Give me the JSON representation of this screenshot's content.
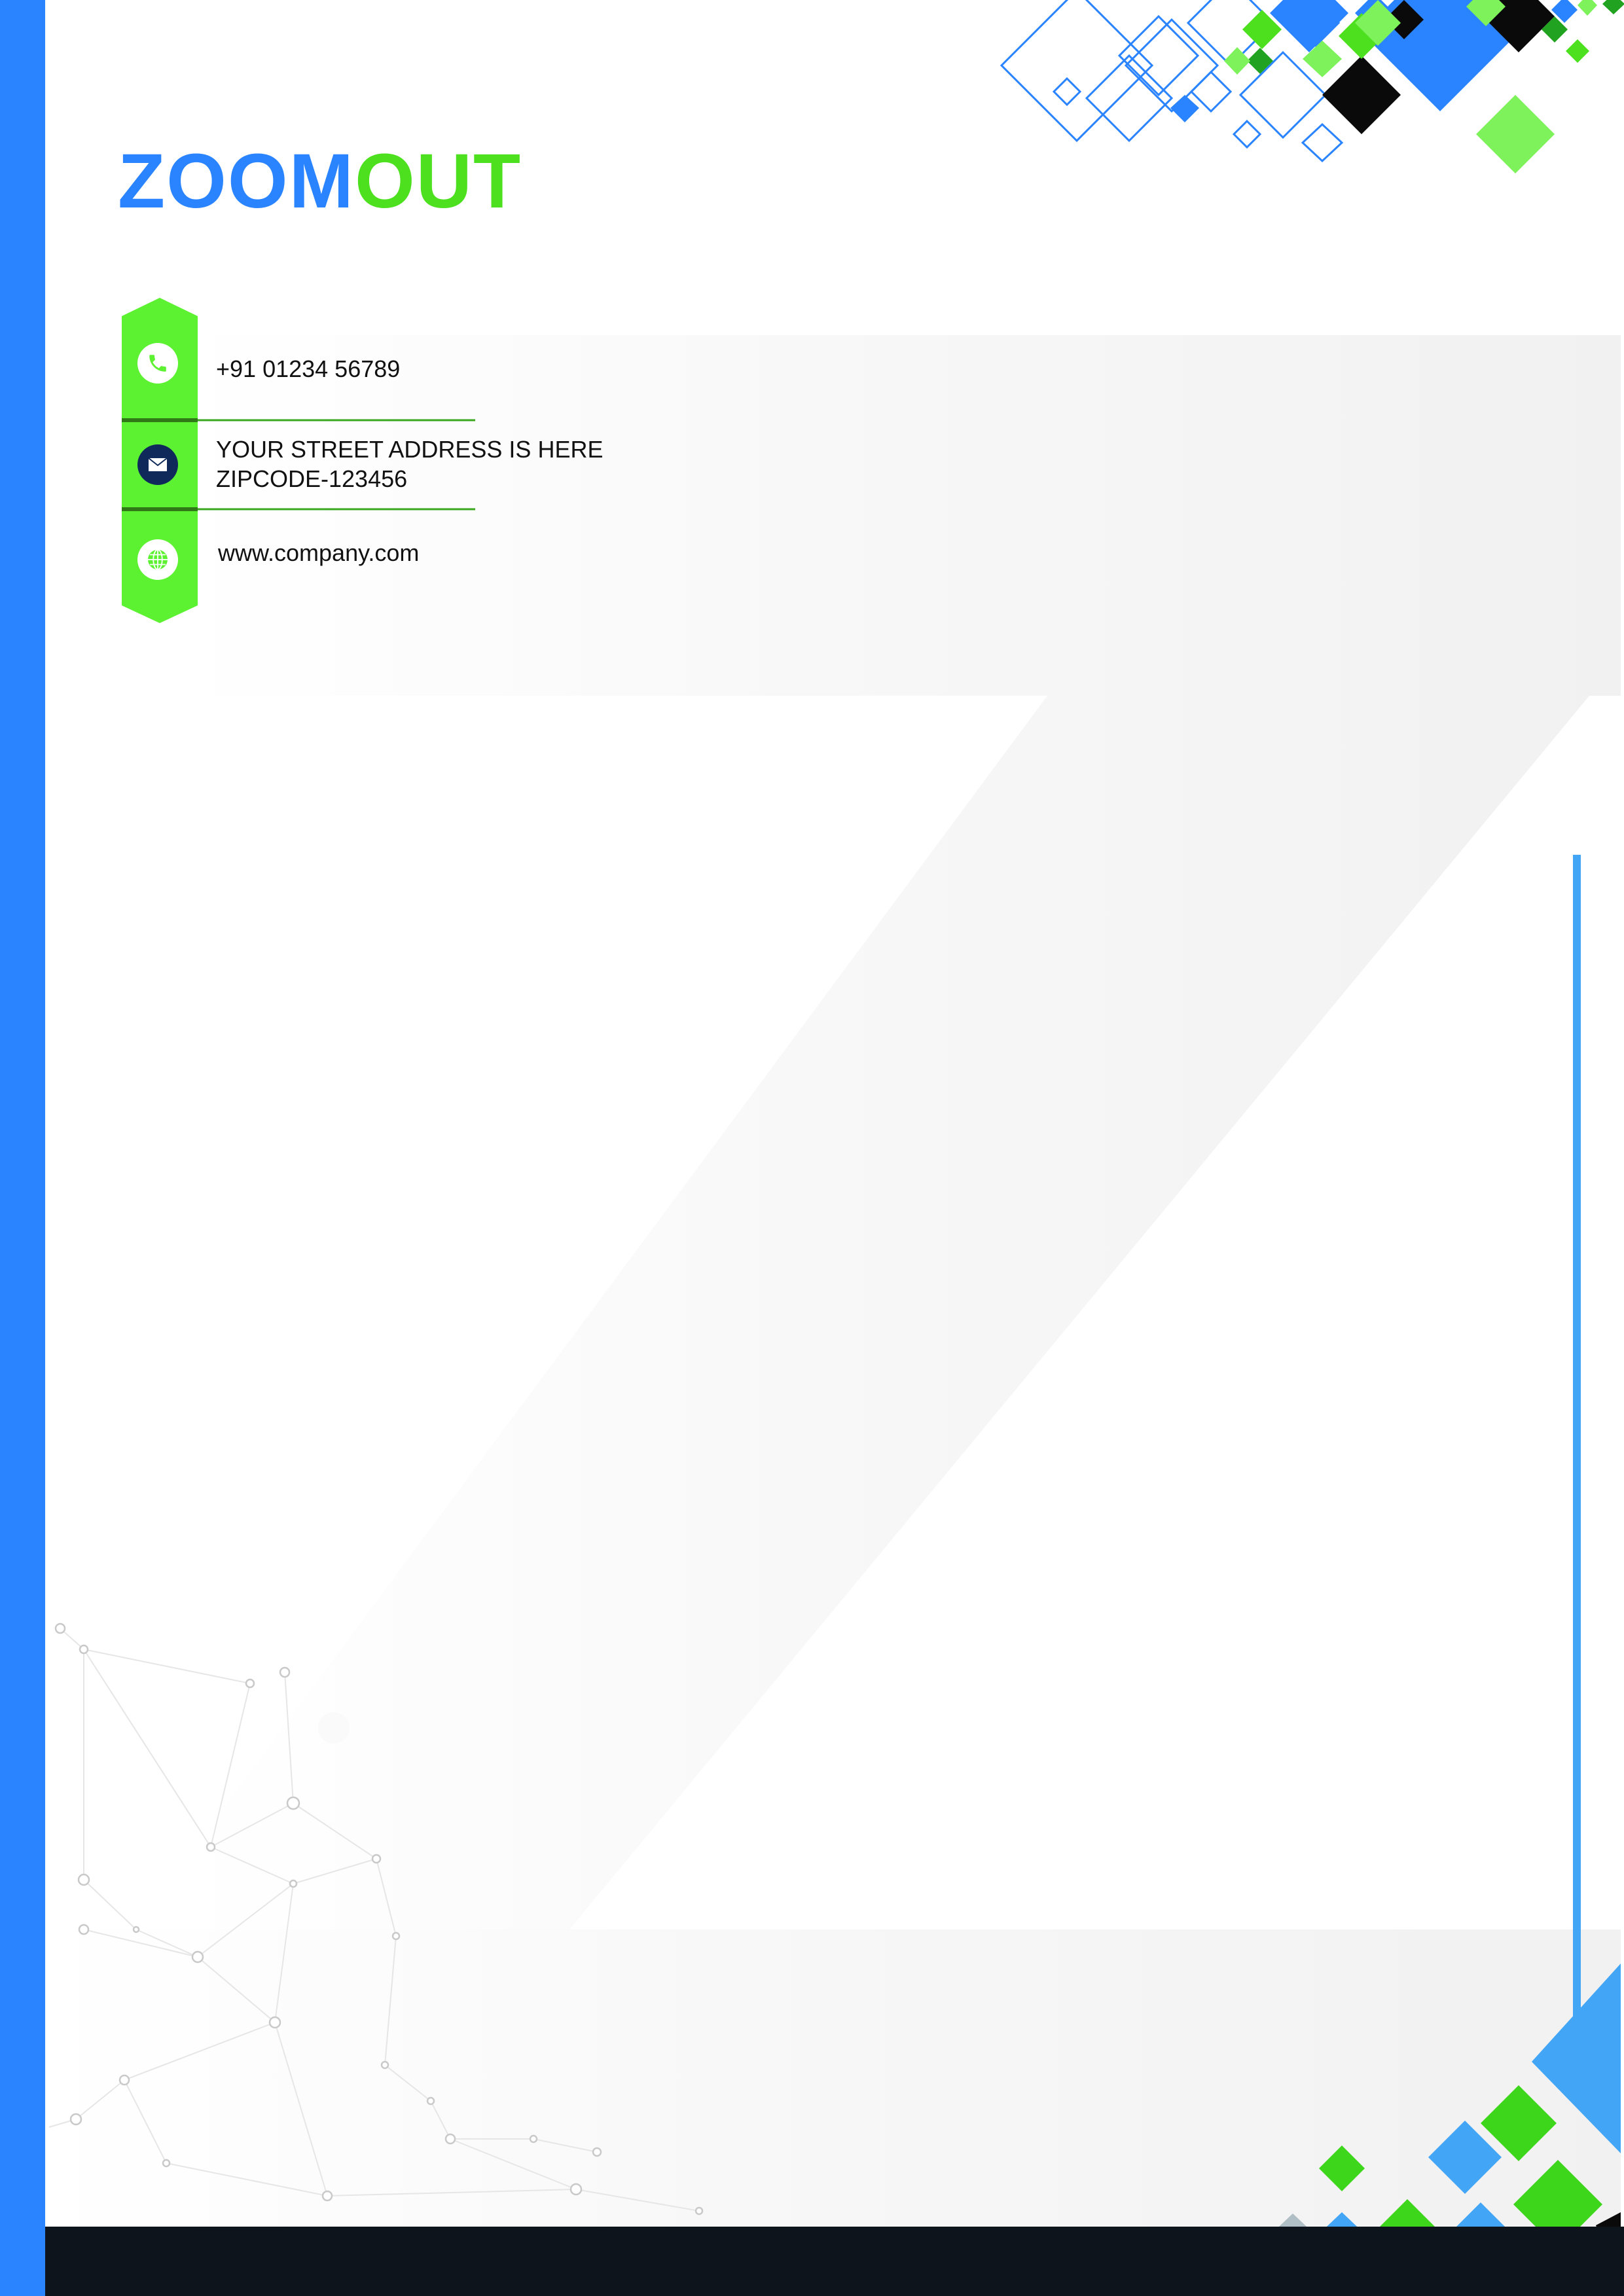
{
  "logo": {
    "part1": "ZOOM",
    "part2": "OUT",
    "color_part1": "#2a84ff",
    "color_part2": "#4ce01e"
  },
  "contact": {
    "phone": "+91 01234 56789",
    "address_line1": "YOUR STREET ADDRESS IS HERE",
    "address_line2": "ZIPCODE-123456",
    "website": "www.company.com",
    "icons": [
      "phone-icon",
      "mail-icon",
      "globe-icon"
    ]
  },
  "colors": {
    "blue": "#2a84ff",
    "light_blue": "#42a5f5",
    "green": "#4ce01e",
    "lime": "#5cf231",
    "dark": "#0e141c",
    "navy": "#0f2a5a"
  }
}
